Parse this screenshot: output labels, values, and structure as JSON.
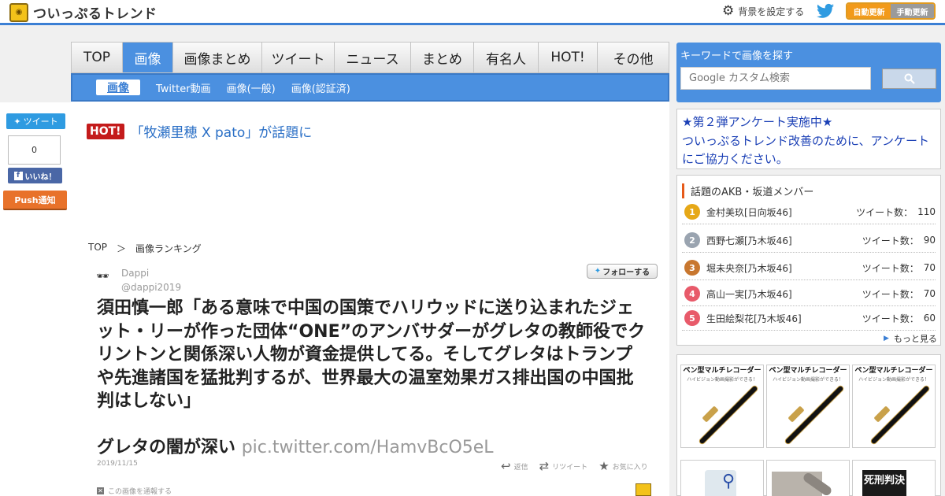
{
  "header": {
    "logo_text": "ついっぷるトレンド",
    "bg_setting": "背景を設定する",
    "auto_update": "自動更新",
    "manual_update": "手動更新"
  },
  "social": {
    "tweet_label": "ツイート",
    "tweet_count": "0",
    "like_label": "いいね！",
    "push_label": "Push通知"
  },
  "tabs": [
    {
      "label": "TOP",
      "active": false
    },
    {
      "label": "画像",
      "active": true
    },
    {
      "label": "画像まとめ",
      "active": false
    },
    {
      "label": "ツイート",
      "active": false
    },
    {
      "label": "ニュース",
      "active": false
    },
    {
      "label": "まとめ",
      "active": false
    },
    {
      "label": "有名人",
      "active": false
    },
    {
      "label": "HOT!",
      "active": false
    },
    {
      "label": "その他",
      "active": false
    }
  ],
  "subnav": [
    {
      "label": "画像",
      "active": true
    },
    {
      "label": "Twitter動画",
      "active": false
    },
    {
      "label": "画像(一般)",
      "active": false
    },
    {
      "label": "画像(認証済)",
      "active": false
    }
  ],
  "hot": {
    "badge": "HOT!",
    "text": "「牧瀬里穂 X pato」が話題に"
  },
  "breadcrumb": {
    "home": "TOP",
    "sep": "＞",
    "current": "画像ランキング"
  },
  "tweet": {
    "user_name": "Dappi",
    "user_id": "@dappi2019",
    "follow_label": "フォローする",
    "text": "須田慎一郎「ある意味で中国の国策でハリウッドに送り込まれたジェット・リーが作った団体“ONE”のアンバサダーがグレタの教師役でクリントンと関係深い人物が資金提供してる。そしてグレタはトランプや先進諸国を猛批判するが、世界最大の温室効果ガス排出国の中国批判はしない」",
    "text2": "グレタの闇が深い",
    "link": "pic.twitter.com/HamvBcO5eL",
    "date": "2019/11/15",
    "reply_label": "返信",
    "retweet_label": "リツイート",
    "fav_label": "お気に入り",
    "report_label": "この画像を通報する"
  },
  "search": {
    "title": "キーワードで画像を探す",
    "placeholder": "Google カスタム検索"
  },
  "enquete": {
    "line1": "★第２弾アンケート実施中★",
    "line2": "ついっぷるトレンド改善のために、アンケートにご協力ください。"
  },
  "ranking": {
    "title": "話題のAKB・坂道メンバー",
    "count_prefix": "ツイート数：",
    "items": [
      {
        "rank": "1",
        "name": "金村美玖[日向坂46]",
        "count": "110",
        "color": "#e6a817"
      },
      {
        "rank": "2",
        "name": "西野七瀬[乃木坂46]",
        "count": "90",
        "color": "#9aa4b0"
      },
      {
        "rank": "3",
        "name": "堀未央奈[乃木坂46]",
        "count": "70",
        "color": "#c8772f"
      },
      {
        "rank": "4",
        "name": "高山一実[乃木坂46]",
        "count": "70",
        "color": "#e85a6a"
      },
      {
        "rank": "5",
        "name": "生田絵梨花[乃木坂46]",
        "count": "60",
        "color": "#e85a6a"
      }
    ],
    "more": "もっと見る"
  },
  "ads": {
    "heading": "ペン型マルチレコーダー",
    "sub": "ハイビジョン動画撮影ができる！",
    "book_title": "死刑判決"
  }
}
